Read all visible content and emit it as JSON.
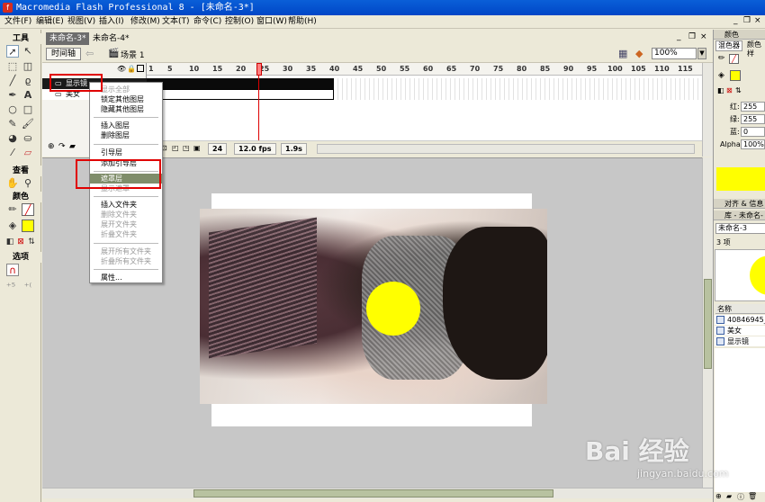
{
  "window": {
    "title": "Macromedia Flash Professional 8 - [未命名-3*]"
  },
  "menu": [
    "文件(F)",
    "编辑(E)",
    "视图(V)",
    "插入(I)",
    "修改(M)",
    "文本(T)",
    "命令(C)",
    "控制(O)",
    "窗口(W)",
    "帮助(H)"
  ],
  "tools": {
    "header": "工具",
    "view_header": "查看",
    "color_header": "颜色",
    "options_header": "选项"
  },
  "doc_tabs": [
    "未命名-3*",
    "未命名-4*"
  ],
  "editbar": {
    "timeline_button": "时间轴",
    "scene": "场景 1",
    "zoom": "100%"
  },
  "timeline": {
    "frame_numbers": [
      "1",
      "5",
      "10",
      "15",
      "20",
      "25",
      "30",
      "35",
      "40",
      "45",
      "50",
      "55",
      "60",
      "65",
      "70",
      "75",
      "80",
      "85",
      "90",
      "95",
      "100",
      "105",
      "110",
      "115"
    ],
    "layers": [
      "显示镜",
      "美女"
    ],
    "status": {
      "current_frame": "24",
      "fps": "12.0 fps",
      "elapsed": "1.9s"
    }
  },
  "context_menu": {
    "items": [
      {
        "label": "显示全部",
        "disabled": true
      },
      {
        "label": "锁定其他图层",
        "disabled": false
      },
      {
        "label": "隐藏其他图层",
        "disabled": false
      },
      {
        "label": "插入图层",
        "disabled": false
      },
      {
        "label": "删除图层",
        "disabled": false
      },
      {
        "label": "引导层",
        "disabled": false
      },
      {
        "label": "添加引导层",
        "disabled": false
      },
      {
        "label": "遮罩层",
        "disabled": false,
        "highlighted": true
      },
      {
        "label": "显示遮罩",
        "disabled": true
      },
      {
        "label": "插入文件夹",
        "disabled": false
      },
      {
        "label": "删除文件夹",
        "disabled": true
      },
      {
        "label": "展开文件夹",
        "disabled": true
      },
      {
        "label": "折叠文件夹",
        "disabled": true
      },
      {
        "label": "展开所有文件夹",
        "disabled": true
      },
      {
        "label": "折叠所有文件夹",
        "disabled": true
      },
      {
        "label": "属性...",
        "disabled": false
      }
    ]
  },
  "right_panel": {
    "color_header": "颜色",
    "mixer_tab": "混色器",
    "swatches_tab": "颜色样",
    "red_label": "红:",
    "red": "255",
    "green_label": "绿:",
    "green": "255",
    "blue_label": "蓝:",
    "blue": "0",
    "alpha_label": "Alpha:",
    "alpha": "100%",
    "align_header": "对齐 & 信息",
    "library_header": "库 - 未命名-",
    "library_doc": "未命名-3",
    "library_count": "3 项",
    "name_col": "名称",
    "library_items": [
      "40846945_",
      "美女",
      "显示镜"
    ]
  },
  "colors": {
    "fill": "#ffff00",
    "accent": "#7f8d6a",
    "highlight_box": "#e00000"
  },
  "watermark": {
    "brand": "Bai 经验",
    "url": "jingyan.baidu.com"
  }
}
